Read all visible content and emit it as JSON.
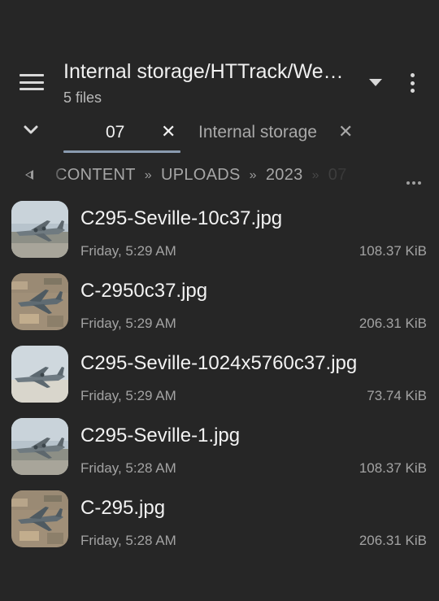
{
  "header": {
    "title": "Internal storage/HTTrack/We…",
    "subtitle": "5 files"
  },
  "tabs": [
    {
      "label": "07",
      "active": true
    },
    {
      "label": "Internal storage",
      "active": false
    }
  ],
  "tab_close_glyph": "✕",
  "breadcrumb": {
    "segments": [
      "CONTENT",
      "UPLOADS",
      "2023",
      "07"
    ],
    "separator": "»"
  },
  "files": [
    {
      "name": "C295-Seville-10c37.jpg",
      "date": "Friday, 5:29 AM",
      "size": "108.37  KiB",
      "thumb": "runway"
    },
    {
      "name": "C-2950c37.jpg",
      "date": "Friday, 5:29 AM",
      "size": "206.31  KiB",
      "thumb": "aerial"
    },
    {
      "name": "C295-Seville-1024x5760c37.jpg",
      "date": "Friday, 5:29 AM",
      "size": "73.74  KiB",
      "thumb": "runway-light"
    },
    {
      "name": "C295-Seville-1.jpg",
      "date": "Friday, 5:28 AM",
      "size": "108.37  KiB",
      "thumb": "runway"
    },
    {
      "name": "C-295.jpg",
      "date": "Friday, 5:28 AM",
      "size": "206.31  KiB",
      "thumb": "aerial"
    }
  ],
  "icons": {
    "menu": "menu-icon",
    "dropdown": "dropdown-arrow-icon",
    "more": "more-vertical-icon",
    "collapse": "chevron-down-icon",
    "back": "back-triangle-icon",
    "breadcrumb_more": "more-horizontal-icon"
  },
  "colors": {
    "background": "#262626",
    "tab_indicator": "#8a9bb0",
    "primary_text": "#f2f2f2",
    "secondary_text": "#a3a3a3"
  }
}
